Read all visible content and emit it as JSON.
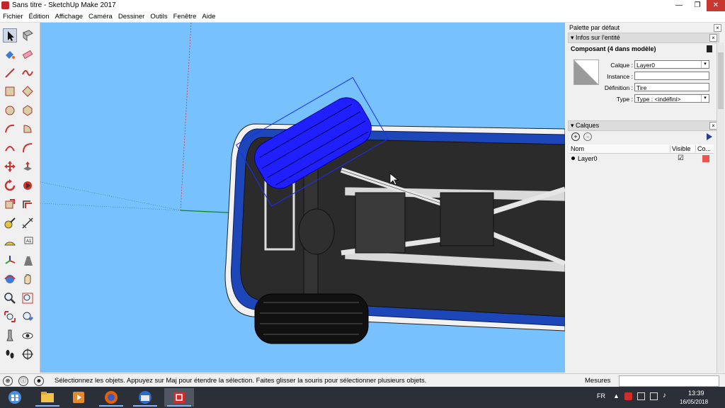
{
  "window": {
    "title": "Sans titre - SketchUp Make 2017",
    "minimize": "—",
    "maximize": "❐",
    "close": "✕"
  },
  "menu": [
    "Fichier",
    "Édition",
    "Affichage",
    "Caméra",
    "Dessiner",
    "Outils",
    "Fenêtre",
    "Aide"
  ],
  "toolbar": {
    "tools": [
      "select",
      "make-component",
      "paint-bucket",
      "eraser",
      "line",
      "freehand",
      "rectangle",
      "rotated-rectangle",
      "circle",
      "polygon",
      "arc",
      "pie",
      "arc-3pt",
      "arc-2pt",
      "move",
      "push-pull",
      "rotate",
      "follow-me",
      "scale",
      "offset",
      "tape-measure",
      "dimension",
      "protractor",
      "text",
      "axes",
      "3d-text",
      "orbit",
      "pan",
      "zoom",
      "zoom-window",
      "zoom-extents",
      "previous",
      "position-camera",
      "look-around",
      "walk",
      "section-plane"
    ]
  },
  "panel": {
    "title": "Palette par défaut",
    "entity_section": "Infos sur l'entité",
    "entity_heading": "Composant (4 dans modèle)",
    "labels": {
      "layer": "Calque :",
      "instance": "Instance :",
      "definition": "Définition :",
      "type": "Type :"
    },
    "values": {
      "layer": "Layer0",
      "instance": "",
      "definition": "Tire",
      "type": "Type : <indéfini>"
    },
    "layers_section": "Calques",
    "layer_columns": [
      "Nom",
      "Visible",
      "Co..."
    ],
    "layers": [
      {
        "name": "Layer0",
        "visible": "☑",
        "color": "#ef5350"
      }
    ],
    "close_glyph": "×"
  },
  "status": {
    "message": "Sélectionnez les objets. Appuyez sur Maj pour étendre la sélection. Faites glisser la souris pour sélectionner plusieurs objets.",
    "measure_label": "Mesures"
  },
  "taskbar": {
    "apps": [
      "windows-start",
      "file-explorer",
      "media-player",
      "firefox",
      "thunderbird",
      "sketchup"
    ],
    "language": "FR",
    "time": "13:39",
    "date": "16/05/2018"
  },
  "colors": {
    "sky": "#77c1ff",
    "selection": "#1b2cff",
    "body_blue": "#1d47b8"
  }
}
